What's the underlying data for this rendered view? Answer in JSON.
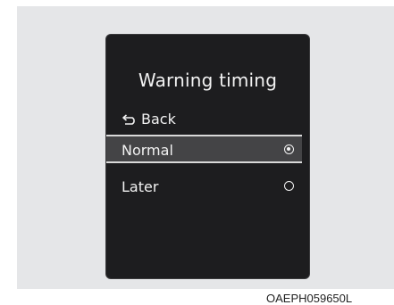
{
  "screen": {
    "title": "Warning timing",
    "back_label": "Back",
    "back_icon": "return-arrow-icon",
    "options": [
      {
        "label": "Normal",
        "selected": true
      },
      {
        "label": "Later",
        "selected": false
      }
    ]
  },
  "caption": "OAEPH059650L",
  "colors": {
    "screen_bg": "#1d1d1f",
    "frame_bg": "#e5e6e8",
    "selected_bg": "#444446",
    "text": "#f2f2f2"
  }
}
